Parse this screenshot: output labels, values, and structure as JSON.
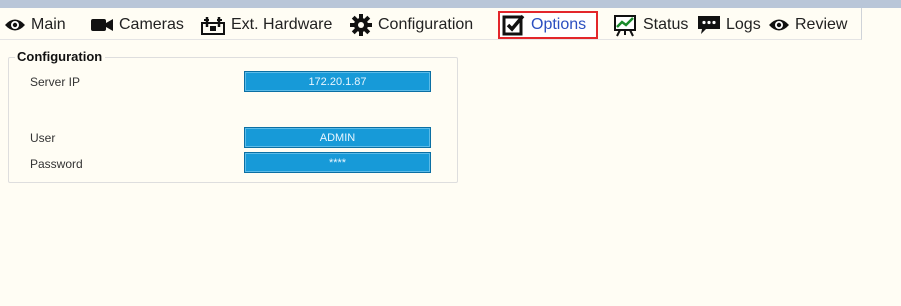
{
  "tabs": [
    {
      "label": "Main",
      "icon": "eye-icon"
    },
    {
      "label": "Cameras",
      "icon": "video-camera-icon"
    },
    {
      "label": "Ext. Hardware",
      "icon": "hardware-icon"
    },
    {
      "label": "Configuration",
      "icon": "gear-icon"
    },
    {
      "label": "Options",
      "icon": "checkbox-icon",
      "active": true
    },
    {
      "label": "Status",
      "icon": "chart-icon"
    },
    {
      "label": "Logs",
      "icon": "chat-icon"
    },
    {
      "label": "Review",
      "icon": "eye-icon"
    }
  ],
  "config": {
    "title": "Configuration",
    "server_ip_label": "Server IP",
    "server_ip_value": "172.20.1.87",
    "user_label": "User",
    "user_value": "ADMIN",
    "password_label": "Password",
    "password_value": "****"
  },
  "colors": {
    "accent_field": "#179ad8",
    "active_tab_border": "#e3262b",
    "active_tab_text": "#2b4fc0",
    "background": "#fffdf4"
  }
}
